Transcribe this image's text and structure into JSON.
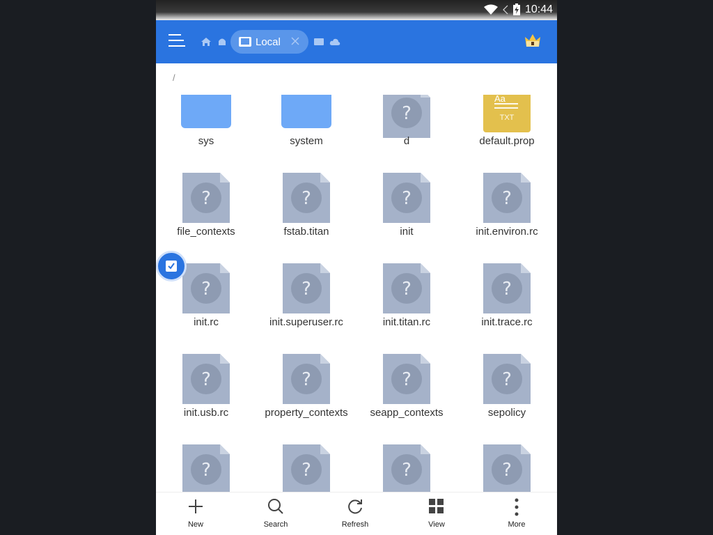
{
  "status": {
    "time": "10:44"
  },
  "toolbar": {
    "tab_label": "Local"
  },
  "path": "/",
  "files": [
    {
      "name": "sys",
      "kind": "folder"
    },
    {
      "name": "system",
      "kind": "folder"
    },
    {
      "name": "d",
      "kind": "unknown"
    },
    {
      "name": "default.prop",
      "kind": "txt"
    },
    {
      "name": "file_contexts",
      "kind": "unknown"
    },
    {
      "name": "fstab.titan",
      "kind": "unknown"
    },
    {
      "name": "init",
      "kind": "unknown"
    },
    {
      "name": "init.environ.rc",
      "kind": "unknown"
    },
    {
      "name": "init.rc",
      "kind": "unknown"
    },
    {
      "name": "init.superuser.rc",
      "kind": "unknown"
    },
    {
      "name": "init.titan.rc",
      "kind": "unknown"
    },
    {
      "name": "init.trace.rc",
      "kind": "unknown"
    },
    {
      "name": "init.usb.rc",
      "kind": "unknown"
    },
    {
      "name": "property_contexts",
      "kind": "unknown"
    },
    {
      "name": "seapp_contexts",
      "kind": "unknown"
    },
    {
      "name": "sepolicy",
      "kind": "unknown"
    },
    {
      "name": "",
      "kind": "unknown"
    },
    {
      "name": "",
      "kind": "unknown"
    },
    {
      "name": "",
      "kind": "unknown"
    },
    {
      "name": "",
      "kind": "unknown"
    }
  ],
  "txt_icon": {
    "top": "Aa",
    "label": "TXT"
  },
  "bottom": [
    {
      "label": "New",
      "icon": "plus-icon"
    },
    {
      "label": "Search",
      "icon": "search-icon"
    },
    {
      "label": "Refresh",
      "icon": "refresh-icon"
    },
    {
      "label": "View",
      "icon": "grid-view-icon"
    },
    {
      "label": "More",
      "icon": "more-vert-icon"
    }
  ],
  "colors": {
    "accent": "#2a74e0",
    "folder": "#6ea9f7",
    "unknown_file": "#a5b2c9",
    "txt_file": "#e3c04d"
  }
}
